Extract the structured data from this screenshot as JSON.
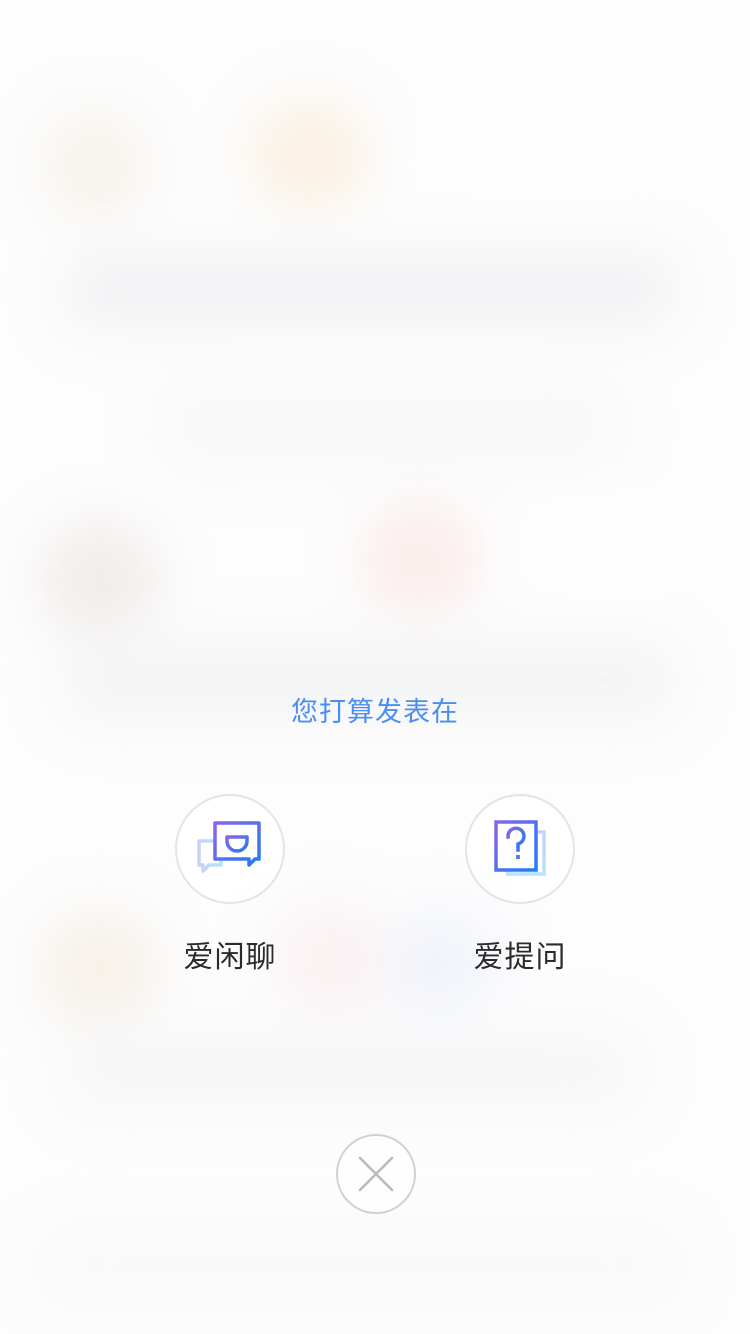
{
  "chooser": {
    "prompt": "您打算发表在",
    "options": [
      {
        "label": "爱闲聊",
        "icon": "chat-bubble-smile-icon"
      },
      {
        "label": "爱提问",
        "icon": "question-card-icon"
      }
    ],
    "close_icon": "close-icon"
  },
  "colors": {
    "accent": "#4a8ef2",
    "icon_gradient_start": "#8a63f0",
    "icon_gradient_end": "#1f7cf2",
    "label_text": "#2b2b2b",
    "circle_border": "#e3e4e8"
  }
}
